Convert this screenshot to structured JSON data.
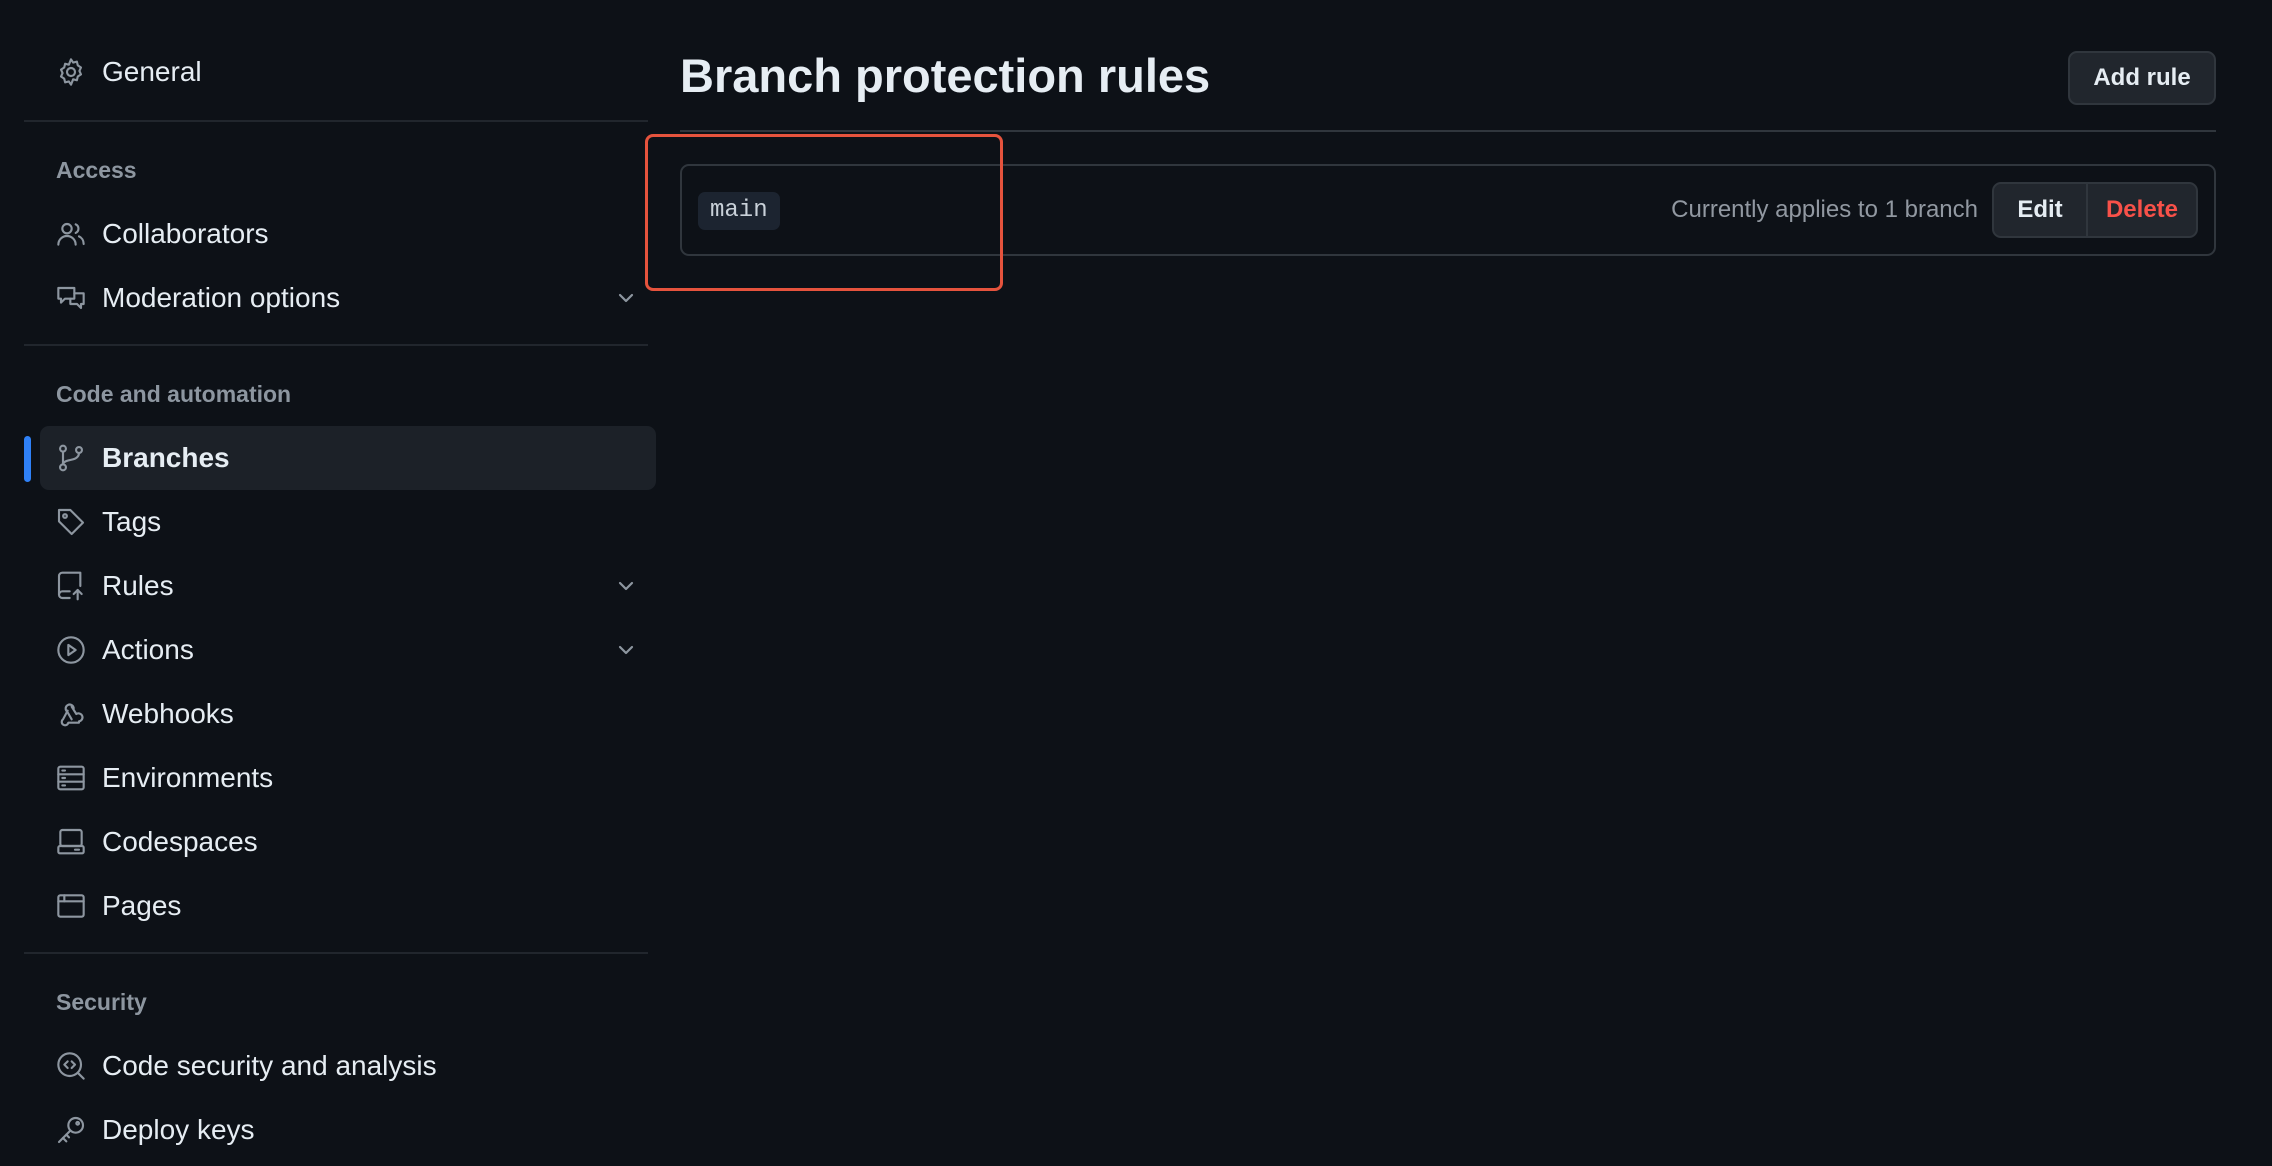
{
  "sidebar": {
    "general": "General",
    "sections": {
      "access": "Access",
      "code_automation": "Code and automation",
      "security": "Security"
    },
    "items": {
      "collaborators": "Collaborators",
      "moderation": "Moderation options",
      "branches": "Branches",
      "tags": "Tags",
      "rules": "Rules",
      "actions": "Actions",
      "webhooks": "Webhooks",
      "environments": "Environments",
      "codespaces": "Codespaces",
      "pages": "Pages",
      "code_security": "Code security and analysis",
      "deploy_keys": "Deploy keys"
    },
    "active_item": "Branches",
    "icons": {
      "general": "gear-icon",
      "collaborators": "people-icon",
      "moderation": "comment-discussion-icon",
      "branches": "git-branch-icon",
      "tags": "tag-icon",
      "rules": "repo-push-icon",
      "actions": "play-icon",
      "webhooks": "webhook-icon",
      "environments": "server-icon",
      "codespaces": "codespaces-icon",
      "pages": "browser-icon",
      "code_security": "codescan-icon",
      "deploy_keys": "key-icon"
    }
  },
  "main": {
    "title": "Branch protection rules",
    "add_rule": "Add rule",
    "rules": [
      {
        "branch": "main",
        "applies": "Currently applies to 1 branch",
        "edit": "Edit",
        "delete": "Delete"
      }
    ]
  },
  "colors": {
    "background": "#0d1117",
    "accent": "#2f81f7",
    "danger": "#f85149",
    "highlight": "#e5533d"
  }
}
